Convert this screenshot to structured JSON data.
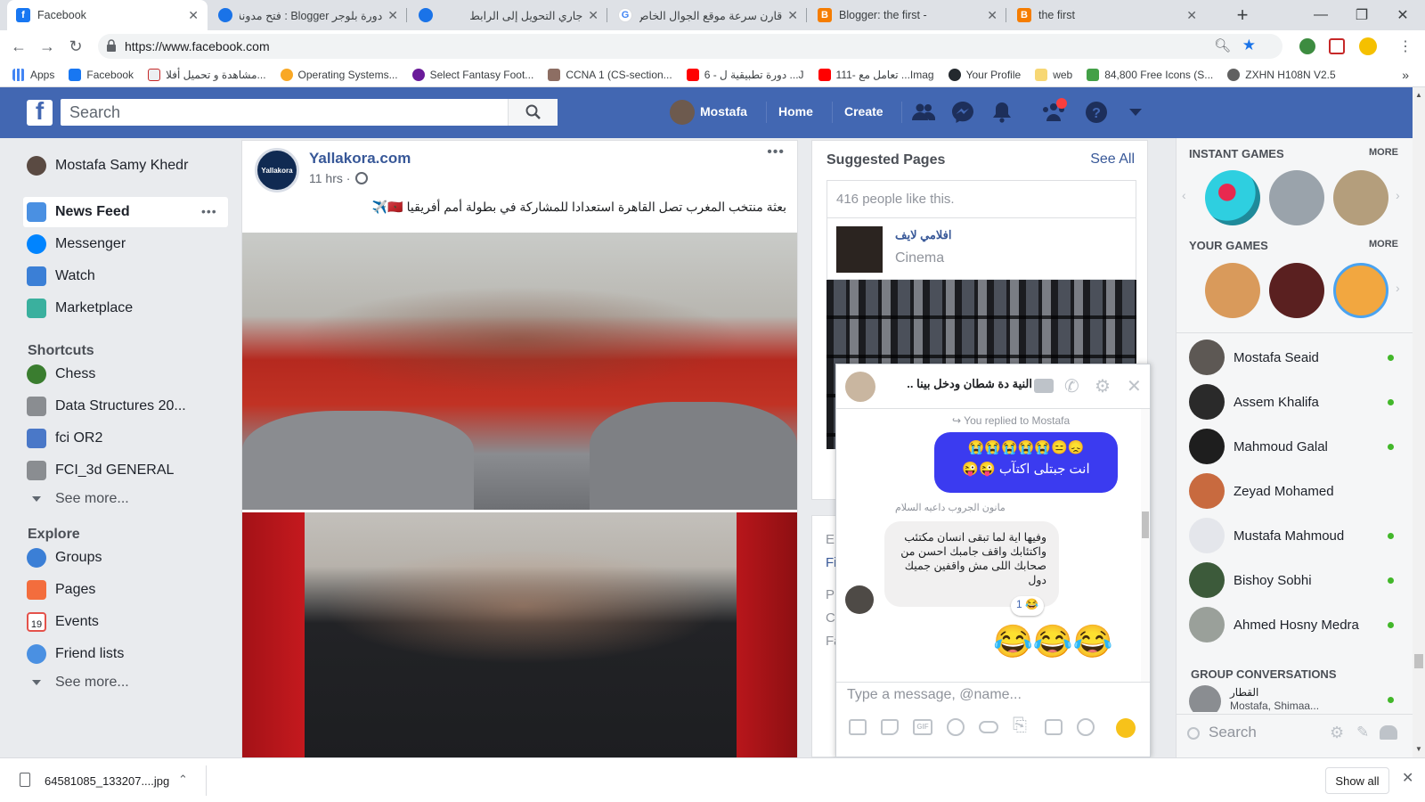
{
  "browser": {
    "tabs": [
      {
        "title": "Facebook",
        "favicon": "facebook-icon",
        "active": true
      },
      {
        "title": "دورة بلوجر Blogger : فتح مدونة و",
        "favicon": "blogger-globe-icon"
      },
      {
        "title": "جاري التحويل إلى الرابط",
        "favicon": "globe-icon"
      },
      {
        "title": "قارن سرعة موقع الجوال الخاص بـ",
        "favicon": "google-icon"
      },
      {
        "title": "Blogger: the first -",
        "favicon": "blogger-icon"
      },
      {
        "title": "the first",
        "favicon": "blogger-icon"
      }
    ],
    "new_tab": "+",
    "url": "https://www.facebook.com",
    "bookmarks": [
      {
        "label": "Apps"
      },
      {
        "label": "Facebook"
      },
      {
        "label": "مشاهدة و تحميل أفلا..."
      },
      {
        "label": "Operating Systems..."
      },
      {
        "label": "Select Fantasy Foot..."
      },
      {
        "label": "CCNA 1 (CS-section..."
      },
      {
        "label": "6 - دورة تطبيقية ل ...J"
      },
      {
        "label": "111- تعامل مع ...Imag"
      },
      {
        "label": "Your Profile"
      },
      {
        "label": "web"
      },
      {
        "label": "84,800 Free Icons (S..."
      },
      {
        "label": "ZXHN H108N V2.5"
      }
    ],
    "more_bookmarks": "»"
  },
  "fb": {
    "search_placeholder": "Search",
    "profile_name": "Mostafa",
    "nav_home": "Home",
    "nav_create": "Create"
  },
  "left": {
    "user": "Mostafa Samy Khedr",
    "main_items": [
      "News Feed",
      "Messenger",
      "Watch",
      "Marketplace"
    ],
    "more_dots": "•••",
    "shortcuts_header": "Shortcuts",
    "shortcuts": [
      "Chess",
      "Data Structures 20...",
      "fci OR2",
      "FCI_3d GENERAL"
    ],
    "see_more": "See more...",
    "explore_header": "Explore",
    "explore": [
      "Groups",
      "Pages",
      "Events",
      "Friend lists"
    ],
    "events_date": "19"
  },
  "post": {
    "page_name": "Yallakora.com",
    "logo_text": "Yallakora",
    "time": "11 hrs ·",
    "menu": "•••",
    "text": "بعثة منتخب المغرب تصل القاهرة استعدادا للمشاركة في بطولة أمم أفريقيا 🇲🇦✈️"
  },
  "suggested": {
    "title": "Suggested Pages",
    "see_all": "See All",
    "likes": "416 people like this.",
    "page_name": "افلامي لايف",
    "page_category": "Cinema",
    "partial_lines": [
      "E",
      "Fi",
      "P",
      "C",
      "Fa"
    ]
  },
  "chat_sidebar": {
    "instant_games": "INSTANT GAMES",
    "your_games": "YOUR GAMES",
    "more": "MORE",
    "contacts": [
      "Mostafa Seaid",
      "Assem Khalifa",
      "Mahmoud Galal",
      "Zeyad Mohamed",
      "Mustafa Mahmoud",
      "Bishoy Sobhi",
      "Ahmed Hosny Medra"
    ],
    "group_header": "GROUP CONVERSATIONS",
    "group_name": "القطار",
    "group_members": "Mostafa, Shimaa...",
    "search_placeholder": "Search"
  },
  "chat": {
    "title": "النية دة شطان ودخل بينا ..",
    "replied": "You replied to Mostafa",
    "my_emojis": "😞😑😭😭😭😭😭",
    "my_text": "انت جبتلى اكتآب 😜😜",
    "sender_label": "مانون الجروب داعيه السلام",
    "their_text": "وفيها اية لما تبقى انسان مكتئب واكتئابك واقف جامبك احسن من صحابك اللى مش واقفين جميك دول",
    "reaction_count": "1",
    "reaction_emoji": "😂",
    "laugh_emojis": "😂😂😂",
    "input_placeholder": "Type a message, @name..."
  },
  "download": {
    "filename": "64581085_133207....jpg",
    "show_all": "Show all"
  },
  "colors": {
    "fb_blue": "#4267b2",
    "link_blue": "#385898",
    "messenger_bubble": "#3b3bf0",
    "online_green": "#42b72a"
  }
}
